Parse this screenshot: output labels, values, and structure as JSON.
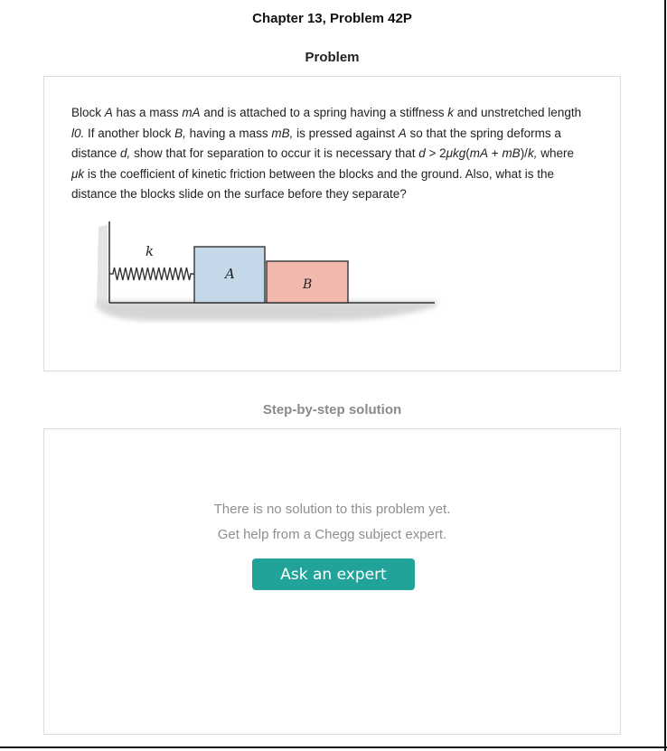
{
  "header": {
    "title": "Chapter 13, Problem 42P"
  },
  "problem": {
    "heading": "Problem",
    "text": [
      {
        "t": "Block "
      },
      {
        "t": "A",
        "i": true
      },
      {
        "t": " has a mass "
      },
      {
        "t": "mA",
        "i": true
      },
      {
        "t": " and is attached to a spring having a stiffness "
      },
      {
        "t": "k",
        "i": true
      },
      {
        "t": " and unstretched length "
      },
      {
        "t": "l0.",
        "i": true
      },
      {
        "t": " If another block "
      },
      {
        "t": "B,",
        "i": true
      },
      {
        "t": " having a mass "
      },
      {
        "t": "mB,",
        "i": true
      },
      {
        "t": " is pressed against "
      },
      {
        "t": "A",
        "i": true
      },
      {
        "t": " so that the spring deforms a distance "
      },
      {
        "t": "d,",
        "i": true
      },
      {
        "t": " show that for separation to occur it is necessary that "
      },
      {
        "t": "d",
        "i": true
      },
      {
        "t": " > 2"
      },
      {
        "t": "μkg",
        "i": true
      },
      {
        "t": "("
      },
      {
        "t": "mA",
        "i": true
      },
      {
        "t": " + "
      },
      {
        "t": "mB",
        "i": true
      },
      {
        "t": ")/"
      },
      {
        "t": "k,",
        "i": true
      },
      {
        "t": " where "
      },
      {
        "t": "μk",
        "i": true
      },
      {
        "t": " is the coefficient of kinetic friction between the blocks and the ground. Also, what is the distance the blocks slide on the surface before they separate?"
      }
    ],
    "figure": {
      "spring_label": "k",
      "block_a_label": "A",
      "block_b_label": "B",
      "colors": {
        "block_a": "#c5d8ea",
        "block_b": "#f1b9ae",
        "outline": "#333333",
        "ground_shadow": "#cfcfcf"
      }
    }
  },
  "solution": {
    "heading": "Step-by-step solution",
    "empty_line1": "There is no solution to this problem yet.",
    "empty_line2": "Get help from a Chegg subject expert.",
    "ask_button": "Ask an expert",
    "colors": {
      "accent": "#22a39a"
    }
  }
}
